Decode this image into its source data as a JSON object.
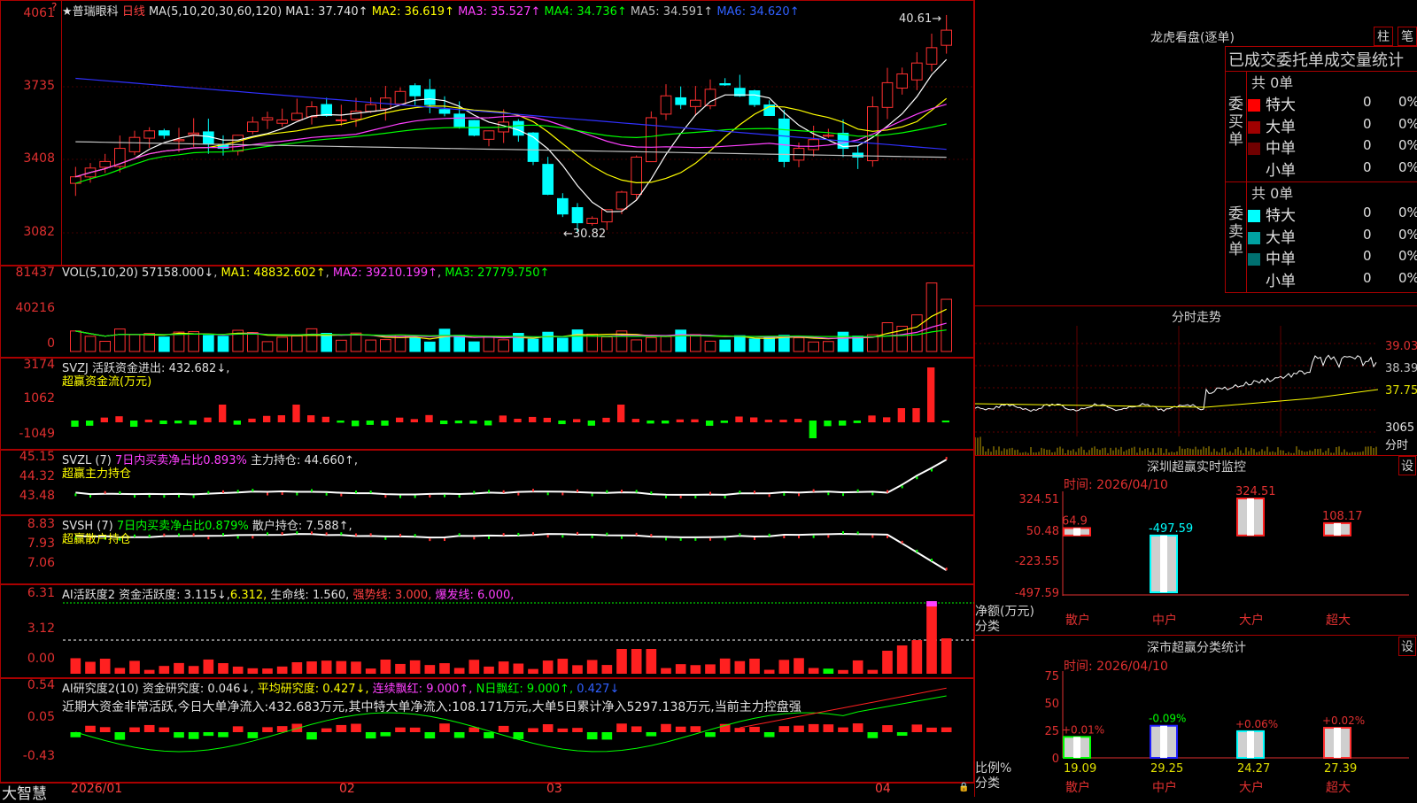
{
  "stock": {
    "name": "普瑞眼科",
    "period": "日线",
    "ma_params": "MA(5,10,20,30,60,120)",
    "mas": [
      {
        "k": "MA1:",
        "v": "37.740↑",
        "c": "#e0e0e0"
      },
      {
        "k": "MA2:",
        "v": "36.619↑",
        "c": "#ffff00"
      },
      {
        "k": "MA3:",
        "v": "35.527↑",
        "c": "#ff40ff"
      },
      {
        "k": "MA4:",
        "v": "34.736↑",
        "c": "#00ff00"
      },
      {
        "k": "MA5:",
        "v": "34.591↑",
        "c": "#c0c0c0"
      },
      {
        "k": "MA6:",
        "v": "34.620↑",
        "c": "#3060ff"
      }
    ],
    "axis": [
      "4061",
      "3735",
      "3408",
      "3082"
    ],
    "high_label": "40.61",
    "low_label": "←30.82"
  },
  "vol": {
    "head": "VOL(5,10,20)",
    "val": "57158.000↓",
    "ma1": "48832.602↑",
    "ma2": "39210.199↑",
    "ma3": "27779.750↑",
    "axis": [
      "81437",
      "40216",
      "0"
    ]
  },
  "svzj": {
    "head": "SVZJ",
    "title": "活跃资金进出:",
    "val": "432.682↓,",
    "sub": "超赢资金流(万元)",
    "axis": [
      "3174",
      "1062",
      "-1049"
    ]
  },
  "svzl": {
    "head": "SVZL (7)",
    "desc": "7日内买卖净占比0.893%",
    "t2": "主力持仓:",
    "val": "44.660↑,",
    "sub": "超赢主力持仓",
    "axis": [
      "45.15",
      "44.32",
      "43.48"
    ]
  },
  "svsh": {
    "head": "SVSH (7)",
    "desc": "7日内买卖净占比0.879%",
    "t2": "散户持仓:",
    "val": "7.588↑,",
    "sub": "超赢散户持仓",
    "axis": [
      "8.83",
      "7.93",
      "7.06"
    ]
  },
  "ai1": {
    "head": "AI活跃度2",
    "t1": "资金活跃度:",
    "v1": "3.115↓,",
    "v2": "6.312,",
    "t3": "生命线:",
    "v3": "1.560,",
    "t4": "强势线:",
    "v4": "3.000,",
    "t5": "爆发线:",
    "v5": "6.000,",
    "axis": [
      "6.31",
      "3.12",
      "0.00"
    ]
  },
  "ai2": {
    "head": "AI研究度2(10)",
    "t1": "资金研究度:",
    "v1": "0.046↓,",
    "t2": "平均研究度:",
    "v2": "0.427↓,",
    "t3": "连续飘红:",
    "v3": "9.000↑,",
    "t4": "N日飘红:",
    "v4": "9.000↑,",
    "v5": "0.427↓",
    "note": "近期大资金非常活跃,今日大单净流入:432.683万元,其中特大单净流入:108.171万元,大单5日累计净入5297.138万元,当前主力控盘强",
    "axis": [
      "0.54",
      "0.05",
      "-0.43"
    ]
  },
  "xaxis": [
    "2026/01",
    "02",
    "03",
    "04"
  ],
  "footer_brand": "大智慧",
  "right": {
    "lh_title": "龙虎看盘(逐单)",
    "btn1": "柱",
    "btn2": "笔",
    "tabs_text": "已成交委托单成交量统计",
    "buy": {
      "side": "委买单",
      "total": "共 0单",
      "rows": [
        {
          "n": "特大",
          "v": "0",
          "p": "0%",
          "c": "#ff0000"
        },
        {
          "n": "大单",
          "v": "0",
          "p": "0%",
          "c": "#a00000"
        },
        {
          "n": "中单",
          "v": "0",
          "p": "0%",
          "c": "#700000"
        },
        {
          "n": "小单",
          "v": "0",
          "p": "0%",
          "c": "#000000"
        }
      ]
    },
    "sell": {
      "side": "委卖单",
      "total": "共 0单",
      "rows": [
        {
          "n": "特大",
          "v": "0",
          "p": "0%",
          "c": "#00ffff"
        },
        {
          "n": "大单",
          "v": "0",
          "p": "0%",
          "c": "#00a0a0"
        },
        {
          "n": "中单",
          "v": "0",
          "p": "0%",
          "c": "#007070"
        },
        {
          "n": "小单",
          "v": "0",
          "p": "0%",
          "c": "#000000"
        }
      ]
    },
    "fs_title": "分时走势",
    "fs_axis": [
      "39.03",
      "38.39",
      "37.75",
      "3065"
    ],
    "fs_unit": "分时",
    "sz_title": "深圳超赢实时监控",
    "sz_btn": "设",
    "sz_time": "时间: 2026/04/10",
    "sz_axis": [
      "324.51",
      "50.48",
      "-223.55",
      "-497.59"
    ],
    "sz_unit": "净额(万元)",
    "sz_cat_label": "分类",
    "sz_bars": [
      {
        "cat": "散户",
        "v": 64.9,
        "lbl": "64.9"
      },
      {
        "cat": "中户",
        "v": -497.59,
        "lbl": "-497.59"
      },
      {
        "cat": "大户",
        "v": 324.51,
        "lbl": "324.51"
      },
      {
        "cat": "超大",
        "v": 108.17,
        "lbl": "108.17"
      }
    ],
    "ss_title": "深市超赢分类统计",
    "ss_btn": "设",
    "ss_time": "时间: 2026/04/10",
    "ss_axis": [
      "75",
      "50",
      "25",
      "0"
    ],
    "ss_unit": "比例%",
    "ss_cat_label": "分类",
    "ss_bars": [
      {
        "cat": "散户",
        "v": 19.09,
        "chg": "+0.01%",
        "c": "#00ff00"
      },
      {
        "cat": "中户",
        "v": 29.25,
        "chg": "-0.09%",
        "c": "#2020ff"
      },
      {
        "cat": "大户",
        "v": 24.27,
        "chg": "+0.06%",
        "c": "#00ffff"
      },
      {
        "cat": "超大",
        "v": 27.39,
        "chg": "+0.02%",
        "c": "#ff3030"
      }
    ]
  },
  "chart_data": [
    {
      "type": "candlestick",
      "title": "普瑞眼科 日线",
      "ylim": [
        30.82,
        40.61
      ],
      "x": [
        "2026/01",
        "02",
        "03",
        "04"
      ],
      "series": [
        {
          "name": "MA1",
          "values": [
            37.74
          ]
        },
        {
          "name": "MA2",
          "values": [
            36.619
          ]
        },
        {
          "name": "MA3",
          "values": [
            35.527
          ]
        },
        {
          "name": "MA4",
          "values": [
            34.736
          ]
        },
        {
          "name": "MA5",
          "values": [
            34.591
          ]
        },
        {
          "name": "MA6",
          "values": [
            34.62
          ]
        }
      ],
      "annotations": [
        "40.61",
        "←30.82"
      ]
    },
    {
      "type": "bar",
      "title": "VOL",
      "ylim": [
        0,
        81437
      ],
      "series": [
        {
          "name": "VOL",
          "values": [
            57158.0
          ]
        },
        {
          "name": "MA1",
          "values": [
            48832.602
          ]
        },
        {
          "name": "MA2",
          "values": [
            39210.199
          ]
        },
        {
          "name": "MA3",
          "values": [
            27779.75
          ]
        }
      ]
    },
    {
      "type": "bar",
      "title": "深圳超赢实时监控",
      "categories": [
        "散户",
        "中户",
        "大户",
        "超大"
      ],
      "values": [
        64.9,
        -497.59,
        324.51,
        108.17
      ],
      "ylabel": "净额(万元)",
      "ylim": [
        -497.59,
        324.51
      ]
    },
    {
      "type": "bar",
      "title": "深市超赢分类统计",
      "categories": [
        "散户",
        "中户",
        "大户",
        "超大"
      ],
      "values": [
        19.09,
        29.25,
        24.27,
        27.39
      ],
      "ylabel": "比例%",
      "ylim": [
        0,
        75
      ]
    }
  ]
}
